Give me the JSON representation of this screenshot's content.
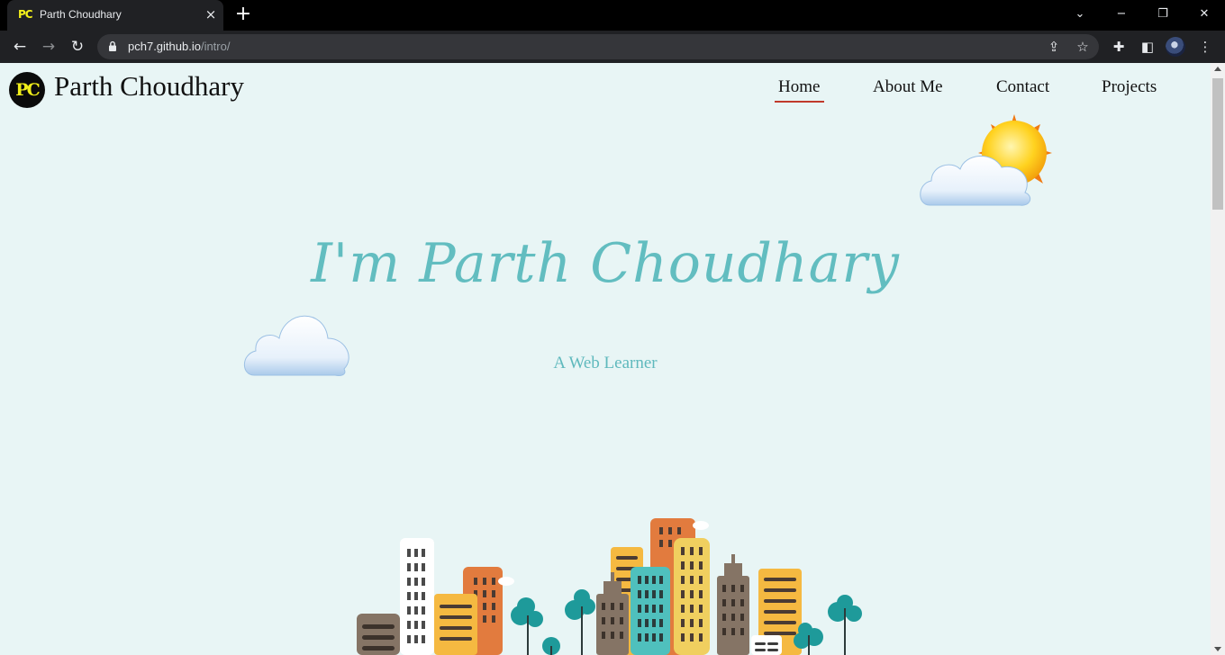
{
  "browser": {
    "tab": {
      "favicon": "PC",
      "title": "Parth Choudhary",
      "close_icon": "×"
    },
    "new_tab_icon": "+",
    "window_controls": {
      "tab_search": "⌄",
      "minimize": "−",
      "restore": "❐",
      "close": "✕"
    },
    "nav": {
      "back": "←",
      "forward": "→",
      "reload": "↻"
    },
    "address": {
      "host": "pch7.github.io",
      "path": "/intro/"
    }
  },
  "site": {
    "logo_text": "PC",
    "brand": "Parth Choudhary",
    "nav": [
      "Home",
      "About Me",
      "Contact",
      "Projects"
    ],
    "active_nav": "Home",
    "accent_color": "#c0392b",
    "hero": {
      "title": "I'm Parth Choudhary",
      "subtitle": "A Web Learner"
    },
    "colors": {
      "background": "#e8f5f5",
      "hero_text": "#62bdc0"
    },
    "decor_icons": [
      "sun-behind-cloud-icon",
      "cloud-icon",
      "city-skyline-illustration"
    ]
  }
}
